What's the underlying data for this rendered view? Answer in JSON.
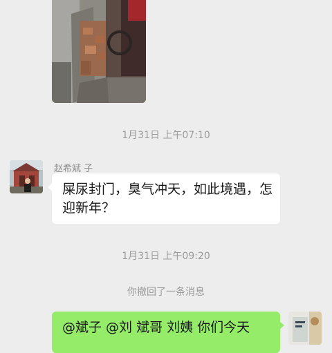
{
  "chat": {
    "timestamp_1": "1月31日 上午07:10",
    "sender_name": "赵希斌  子",
    "message_1": "屎尿封门，臭气冲天，如此境遇，怎迎新年？",
    "timestamp_2": "1月31日 上午09:20",
    "recall_notice": "你撤回了一条消息",
    "my_message": "@斌子 @刘  斌哥 刘姨 你们今天"
  },
  "colors": {
    "background": "#ededed",
    "incoming_bubble": "#ffffff",
    "outgoing_bubble": "#95ec69",
    "timestamp_text": "#9a9a9a"
  }
}
